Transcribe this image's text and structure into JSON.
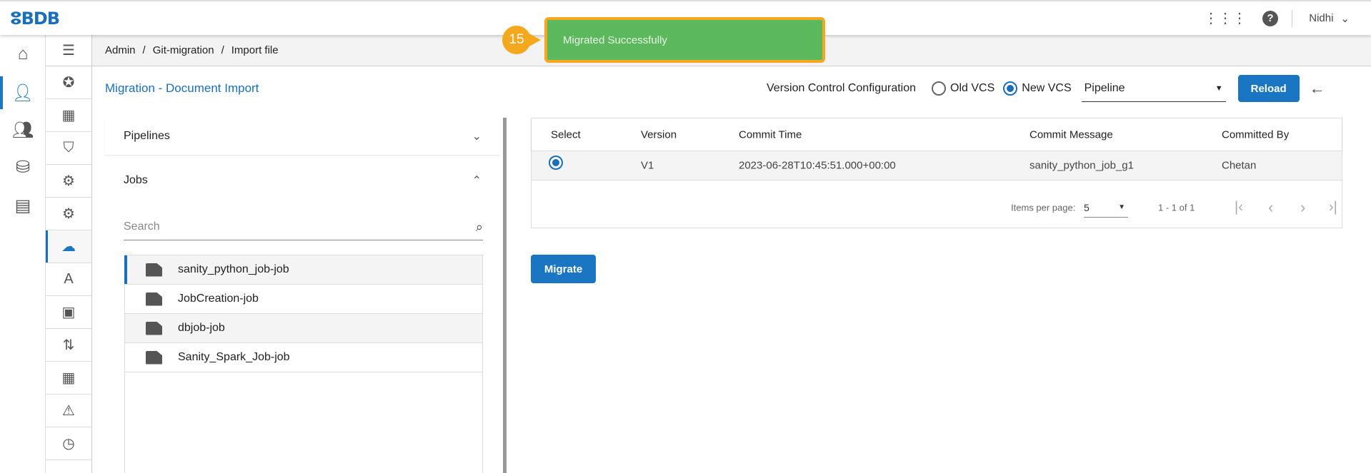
{
  "header": {
    "logo": "BDB",
    "user": "Nidhi"
  },
  "breadcrumb": [
    "Admin",
    "Git-migration",
    "Import file"
  ],
  "page_title": "Migration - Document Import",
  "vcs": {
    "label": "Version Control Configuration",
    "old": "Old VCS",
    "new": "New VCS",
    "selected": "new",
    "type_value": "Pipeline",
    "reload": "Reload"
  },
  "left": {
    "pipelines": "Pipelines",
    "jobs": "Jobs",
    "search_placeholder": "Search",
    "items": [
      {
        "label": "sanity_python_job-job"
      },
      {
        "label": "JobCreation-job"
      },
      {
        "label": "dbjob-job"
      },
      {
        "label": "Sanity_Spark_Job-job"
      }
    ]
  },
  "table": {
    "headers": [
      "Select",
      "Version",
      "Commit Time",
      "Commit Message",
      "Committed By"
    ],
    "rows": [
      {
        "version": "V1",
        "time": "2023-06-28T10:45:51.000+00:00",
        "message": "sanity_python_job_g1",
        "by": "Chetan",
        "selected": true
      }
    ],
    "items_per_page_label": "Items per page:",
    "items_per_page": "5",
    "range": "1 - 1 of 1"
  },
  "migrate": "Migrate",
  "toast": {
    "message": "Migrated Successfully",
    "step": "15"
  },
  "colors": {
    "accent": "#1a76c2",
    "toast": "#5cb85c",
    "callout": "#f4a81d"
  }
}
